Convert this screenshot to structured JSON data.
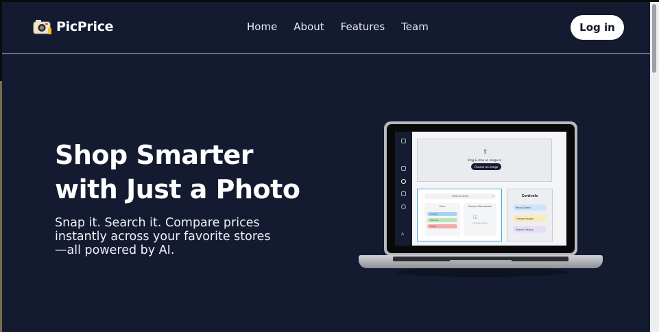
{
  "brand": {
    "name": "PicPrice",
    "logo_icon": "camera-icon"
  },
  "nav": [
    {
      "label": "Home"
    },
    {
      "label": "About"
    },
    {
      "label": "Features"
    },
    {
      "label": "Team"
    }
  ],
  "header": {
    "login_label": "Log in"
  },
  "hero": {
    "title_line1": "Shop Smarter",
    "title_line2": "with Just a Photo",
    "subtitle_line1": "Snap it. Search it. Compare prices",
    "subtitle_line2": "instantly across your favorite stores",
    "subtitle_line3": "—all powered by AI."
  },
  "mockup": {
    "upload_text": "Drag & drop an image or",
    "choose_button": "Choose an image",
    "product_name": "Product Name",
    "price_label": "Price",
    "description_label": "Product Description",
    "description_placeholder": "preview image",
    "price_chips": [
      {
        "label": "Amazon",
        "color": "#a9d3f2"
      },
      {
        "label": "Walmart",
        "color": "#b9e7b4"
      },
      {
        "label": "Target",
        "color": "#f4a9a8"
      }
    ],
    "controls_title": "Controls",
    "controls": [
      {
        "label": "Retry Search",
        "color": "#cfe4fb",
        "icon": "refresh-icon"
      },
      {
        "label": "Change Image",
        "color": "#fbe9b7",
        "icon": "image-icon"
      },
      {
        "label": "Search History",
        "color": "#e6dcf6",
        "icon": "search-icon"
      }
    ],
    "sidebar_letter": "A"
  },
  "colors": {
    "background": "#141b31",
    "accent": "#ffffff",
    "result_border": "#49a3d6"
  }
}
